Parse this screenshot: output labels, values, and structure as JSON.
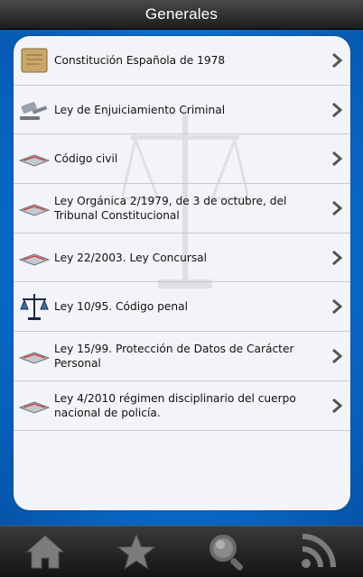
{
  "header": {
    "title": "Generales"
  },
  "items": [
    {
      "label": "Constitución Española de 1978",
      "icon": "parchment-icon"
    },
    {
      "label": "Ley de Enjuiciamiento Criminal",
      "icon": "gavel-icon"
    },
    {
      "label": "Código civil",
      "icon": "book-icon"
    },
    {
      "label": "Ley Orgánica 2/1979, de 3 de octubre, del Tribunal Constitucional",
      "icon": "book-icon"
    },
    {
      "label": "Ley 22/2003. Ley Concursal",
      "icon": "book-icon"
    },
    {
      "label": "Ley 10/95. Código penal",
      "icon": "scales-icon"
    },
    {
      "label": "Ley 15/99. Protección de Datos de Carácter Personal",
      "icon": "book-icon"
    },
    {
      "label": "Ley 4/2010 régimen disciplinario del cuerpo nacional de policía.",
      "icon": "book-icon"
    }
  ],
  "tabbar": {
    "tabs": [
      {
        "name": "home-icon"
      },
      {
        "name": "star-icon"
      },
      {
        "name": "search-icon"
      },
      {
        "name": "rss-icon"
      }
    ]
  },
  "colors": {
    "background": "#0a6fd0",
    "card": "#f3f4f7",
    "bar": "#1c1c1c"
  }
}
